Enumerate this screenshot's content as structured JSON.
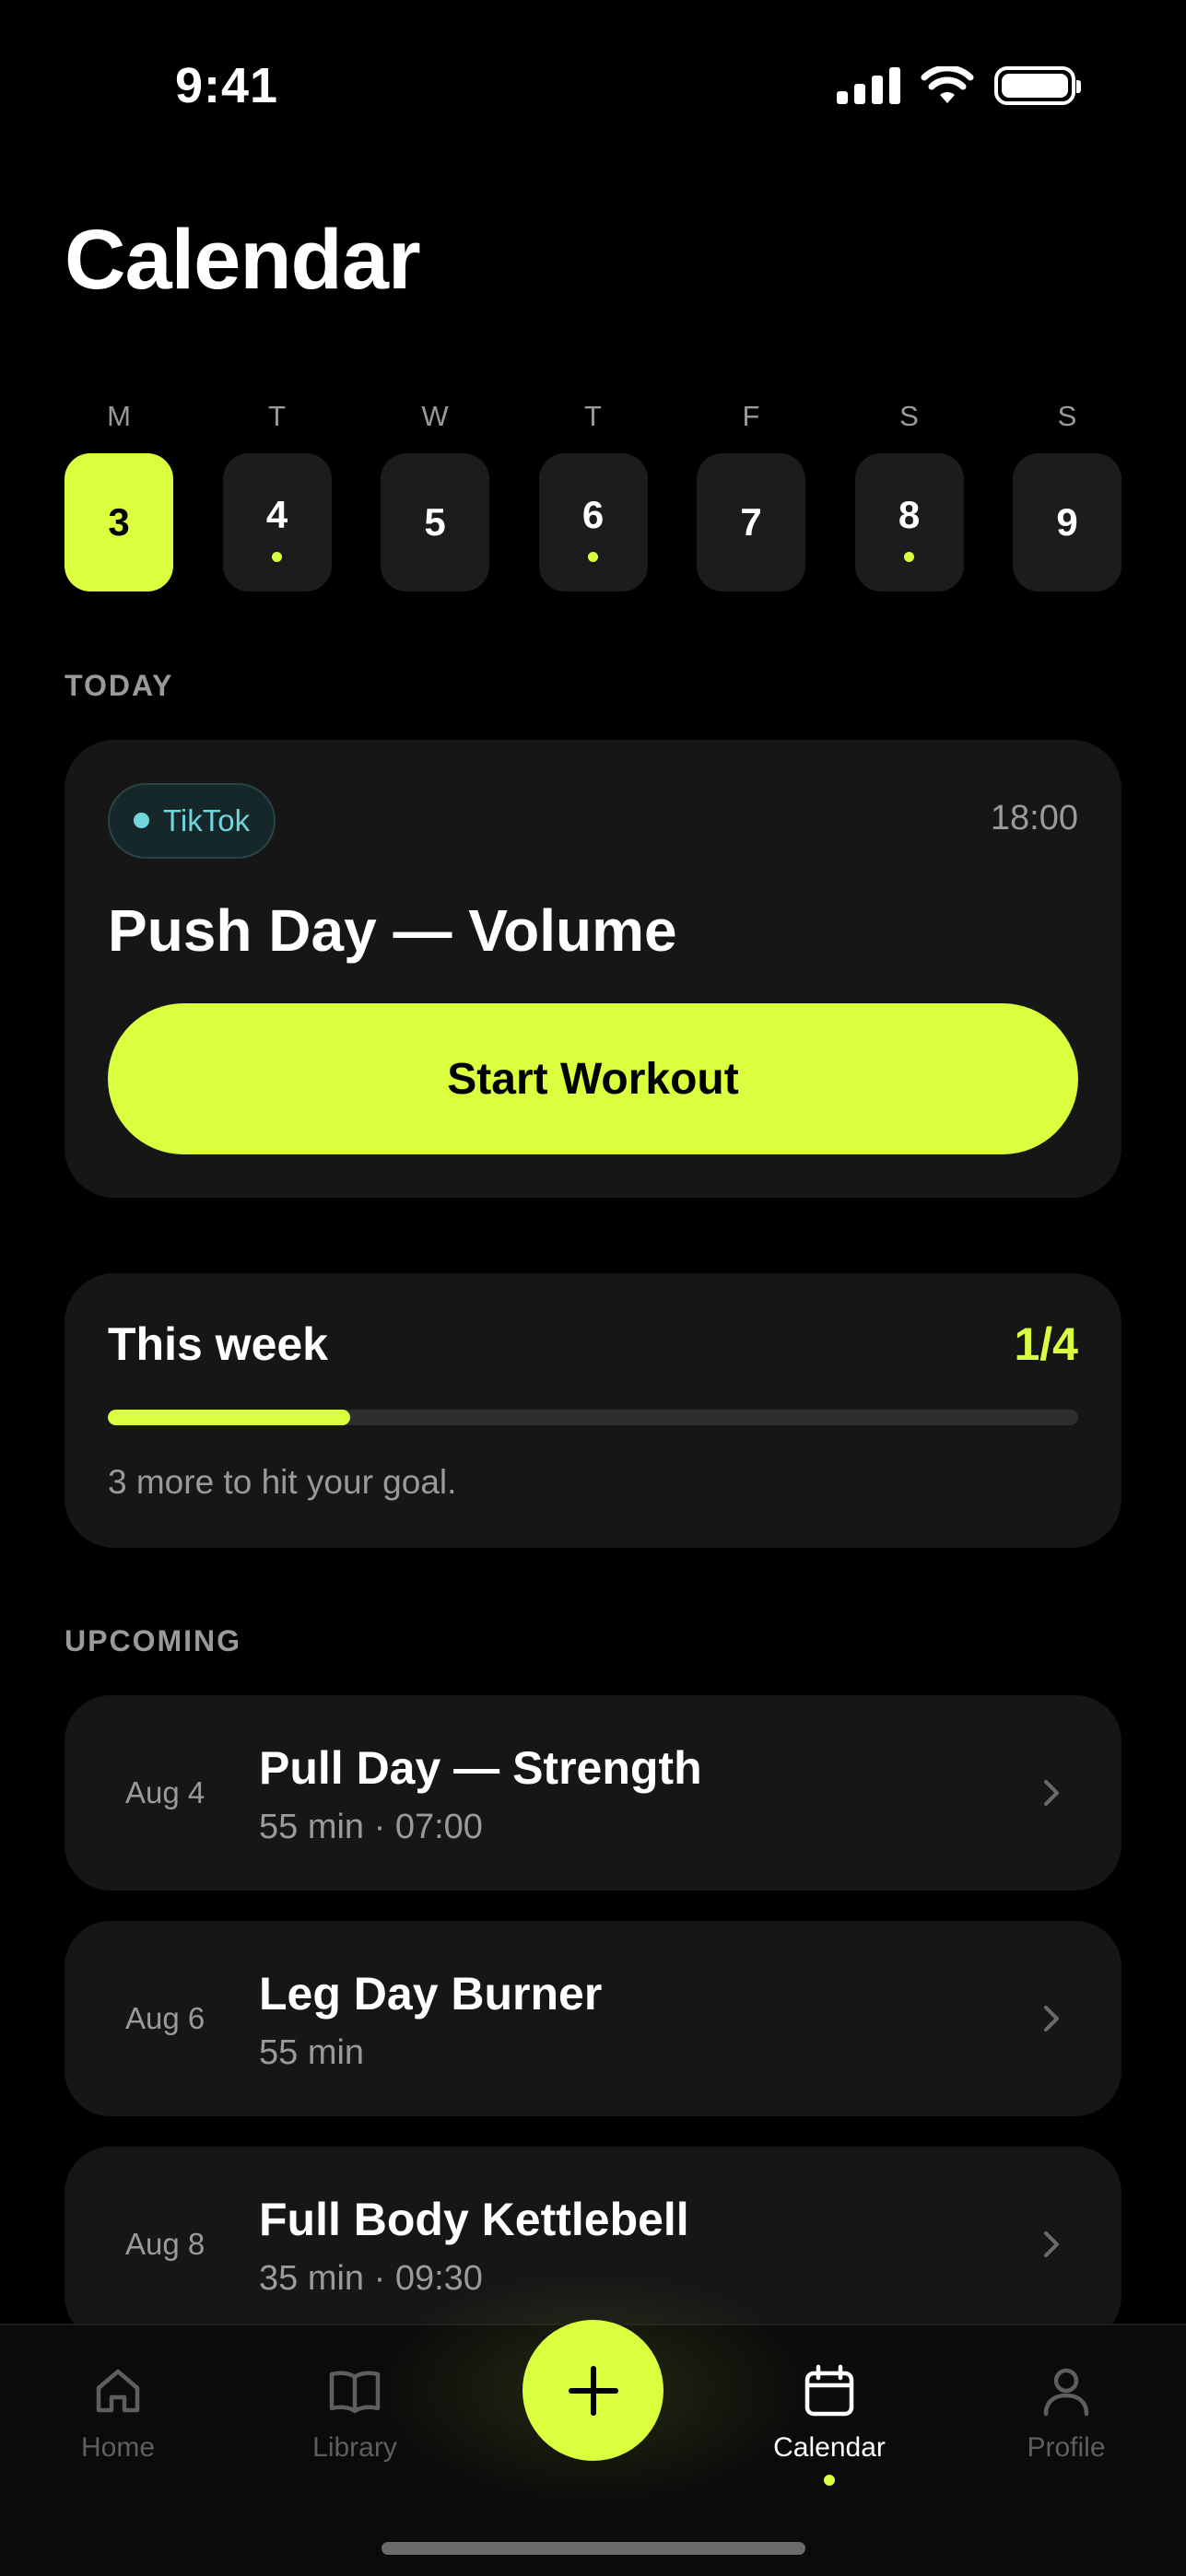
{
  "status_bar": {
    "time": "9:41"
  },
  "page_title": "Calendar",
  "week": {
    "days": [
      {
        "letter": "M",
        "number": "3",
        "selected": true,
        "has_event": false
      },
      {
        "letter": "T",
        "number": "4",
        "selected": false,
        "has_event": true
      },
      {
        "letter": "W",
        "number": "5",
        "selected": false,
        "has_event": false
      },
      {
        "letter": "T",
        "number": "6",
        "selected": false,
        "has_event": true
      },
      {
        "letter": "F",
        "number": "7",
        "selected": false,
        "has_event": false
      },
      {
        "letter": "S",
        "number": "8",
        "selected": false,
        "has_event": true
      },
      {
        "letter": "S",
        "number": "9",
        "selected": false,
        "has_event": false
      }
    ]
  },
  "today": {
    "section_label": "TODAY",
    "tag": "TikTok",
    "time": "18:00",
    "workout_title": "Push Day — Volume",
    "start_label": "Start Workout"
  },
  "this_week": {
    "title": "This week",
    "count": "1/4",
    "progress_fraction": 0.25,
    "note": "3 more to hit your goal."
  },
  "upcoming": {
    "section_label": "UPCOMING",
    "items": [
      {
        "date": "Aug 4",
        "title": "Pull Day — Strength",
        "meta": "55 min · 07:00"
      },
      {
        "date": "Aug 6",
        "title": "Leg Day Burner",
        "meta": "55 min"
      },
      {
        "date": "Aug 8",
        "title": "Full Body Kettlebell",
        "meta": "35 min · 09:30"
      }
    ]
  },
  "tab_bar": {
    "home": "Home",
    "library": "Library",
    "calendar": "Calendar",
    "profile": "Profile",
    "active": "calendar"
  },
  "colors": {
    "accent": "#d9ff3f",
    "background": "#000000",
    "card": "#161616",
    "tag_text": "#6fd6dc"
  }
}
